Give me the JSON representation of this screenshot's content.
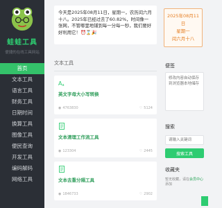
{
  "sidebar": {
    "brand": "蛙蛙工具",
    "slogan": "便捷的在线工具网站",
    "items": [
      {
        "label": "首页",
        "active": true
      },
      {
        "label": "文本工具"
      },
      {
        "label": "语言工具"
      },
      {
        "label": "财务工具"
      },
      {
        "label": "日期时间"
      },
      {
        "label": "换算工具"
      },
      {
        "label": "图像工具"
      },
      {
        "label": "便民查询"
      },
      {
        "label": "开发工具"
      },
      {
        "label": "编码解码"
      },
      {
        "label": "网络工具"
      }
    ]
  },
  "banner": {
    "text": "今天是2025年08月11日，星期一，农历闰六月十八。2025年已经过去了60.82%，时间像一张网，不管哪里地铺到每一分每一秒，我们要好好利用它！⏰⌛🎉"
  },
  "section": {
    "title": "文本工具"
  },
  "cards": [
    {
      "title": "英文字母大小写转换",
      "views": "4763830",
      "favs": "5124",
      "icon": "font-case-icon"
    },
    {
      "title": "文本清理工作流工具",
      "views": "123304",
      "favs": "2445",
      "icon": "document-icon"
    },
    {
      "title": "文本去重分隔工具",
      "views": "1846733",
      "favs": "2902",
      "icon": "document-icon"
    }
  ],
  "right": {
    "date_lines": [
      "2025年08月11日",
      "星期一",
      "闰六月十八"
    ],
    "memo_title": "便签",
    "memo_placeholder": "修改内容自动保存到浏览器本地储存",
    "search_title": "搜索",
    "search_placeholder": "请输入关键词",
    "search_button": "搜索工具",
    "fav_title": "收藏夹",
    "fav_text_1": "暂无收藏，请在",
    "fav_link": "会员中心",
    "fav_text_2": "添加"
  },
  "colors": {
    "accent": "#2ecc71",
    "sidebar_bg": "#2b2f36",
    "date_accent": "#e67e22"
  }
}
